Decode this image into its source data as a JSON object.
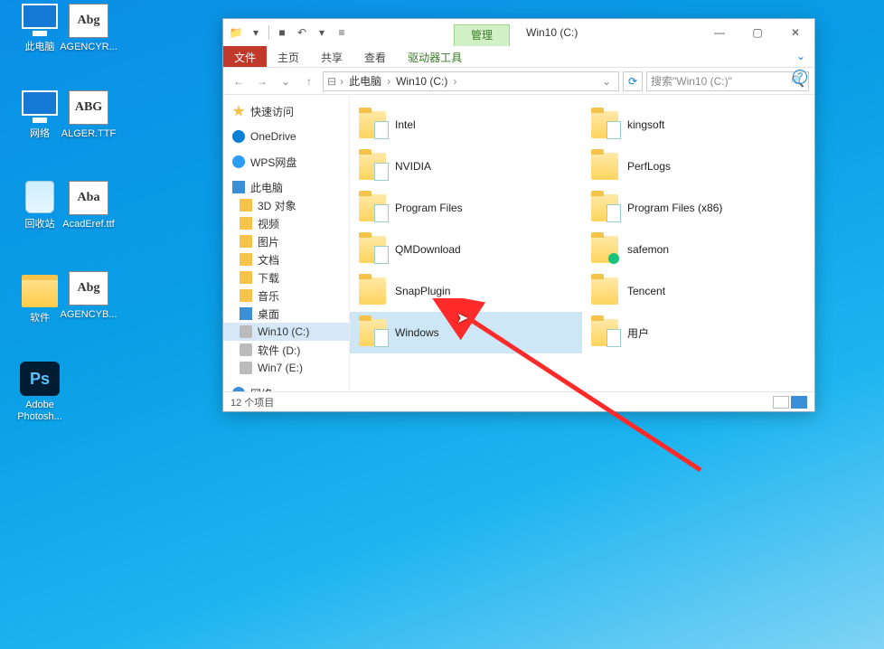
{
  "desktop_icons": [
    {
      "label": "此电脑",
      "type": "pc"
    },
    {
      "label": "AGENCYR...",
      "type": "font",
      "glyph": "Abg"
    },
    {
      "label": "网络",
      "type": "pc"
    },
    {
      "label": "ALGER.TTF",
      "type": "font",
      "glyph": "ABG"
    },
    {
      "label": "回收站",
      "type": "bin"
    },
    {
      "label": "AcadEref.ttf",
      "type": "font",
      "glyph": "Aba"
    },
    {
      "label": "软件",
      "type": "folder"
    },
    {
      "label": "AGENCYB...",
      "type": "font",
      "glyph": "Abg"
    },
    {
      "label": "Adobe Photosh...",
      "type": "ps",
      "glyph": "Ps"
    }
  ],
  "window": {
    "ribbon_context_tab": "管理",
    "title": "Win10 (C:)",
    "tabs": {
      "file": "文件",
      "home": "主页",
      "share": "共享",
      "view": "查看",
      "drive": "驱动器工具"
    },
    "breadcrumb": [
      "此电脑",
      "Win10 (C:)"
    ],
    "search_placeholder": "搜索\"Win10 (C:)\"",
    "sidebar": {
      "quick": "快速访问",
      "onedrive": "OneDrive",
      "wps": "WPS网盘",
      "thispc": "此电脑",
      "children": [
        "3D 对象",
        "视频",
        "图片",
        "文档",
        "下载",
        "音乐",
        "桌面"
      ],
      "drives": [
        "Win10 (C:)",
        "软件 (D:)",
        "Win7 (E:)"
      ],
      "network": "网络"
    },
    "folders_col1": [
      {
        "n": "Intel",
        "t": "paper"
      },
      {
        "n": "NVIDIA",
        "t": "paper"
      },
      {
        "n": "Program Files",
        "t": "paper"
      },
      {
        "n": "QMDownload",
        "t": "paper"
      },
      {
        "n": "SnapPlugin",
        "t": ""
      },
      {
        "n": "Windows",
        "t": "paper",
        "sel": true
      }
    ],
    "folders_col2": [
      {
        "n": "kingsoft",
        "t": "paper"
      },
      {
        "n": "PerfLogs",
        "t": ""
      },
      {
        "n": "Program Files (x86)",
        "t": "paper"
      },
      {
        "n": "safemon",
        "t": "exe"
      },
      {
        "n": "Tencent",
        "t": ""
      },
      {
        "n": "用户",
        "t": "paper"
      }
    ],
    "status": "12 个项目"
  }
}
